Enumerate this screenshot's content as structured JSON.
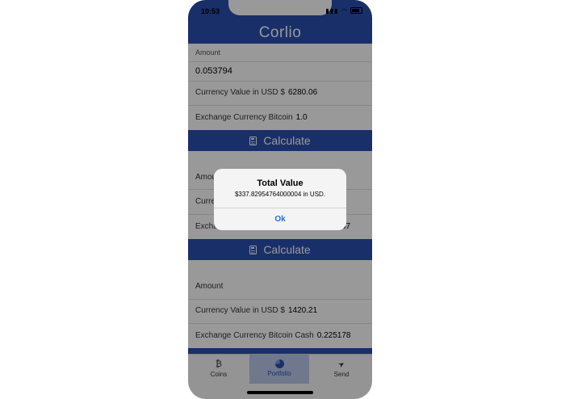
{
  "status": {
    "time": "10:53",
    "signal": "▮▮▮",
    "wifi": "◠"
  },
  "app": {
    "title": "Corlio"
  },
  "cards": [
    {
      "amount_label": "Amount",
      "amount_value": "0.053794",
      "currency_label": "Currency Value in USD $",
      "currency_value": "6280.06",
      "exchange_label": "Exchange Currency Bitcoin",
      "exchange_value": "1.0",
      "button_label": "Calculate"
    },
    {
      "amount_label": "Amount",
      "currency_label": "Currency Value in USD $",
      "exchange_label": "Exchange Currency",
      "exchange_value": "57",
      "button_label": "Calculate"
    },
    {
      "amount_label": "Amount",
      "currency_label": "Currency Value in USD $",
      "currency_value": "1420.21",
      "exchange_label": "Exchange Currency Bitcoin Cash",
      "exchange_value": "0.225178"
    }
  ],
  "tabs": [
    {
      "label": "Coins",
      "icon": "bitcoin-icon",
      "glyph": "₿"
    },
    {
      "label": "Portfolio",
      "icon": "pie-chart-icon"
    },
    {
      "label": "Send",
      "icon": "send-icon",
      "glyph": "➤"
    }
  ],
  "alert": {
    "title": "Total Value",
    "message": "$337.82954764000004 in USD.",
    "ok_label": "Ok"
  },
  "colors": {
    "brand": "#2a4fb0",
    "alert_button": "#1f6fe0"
  }
}
